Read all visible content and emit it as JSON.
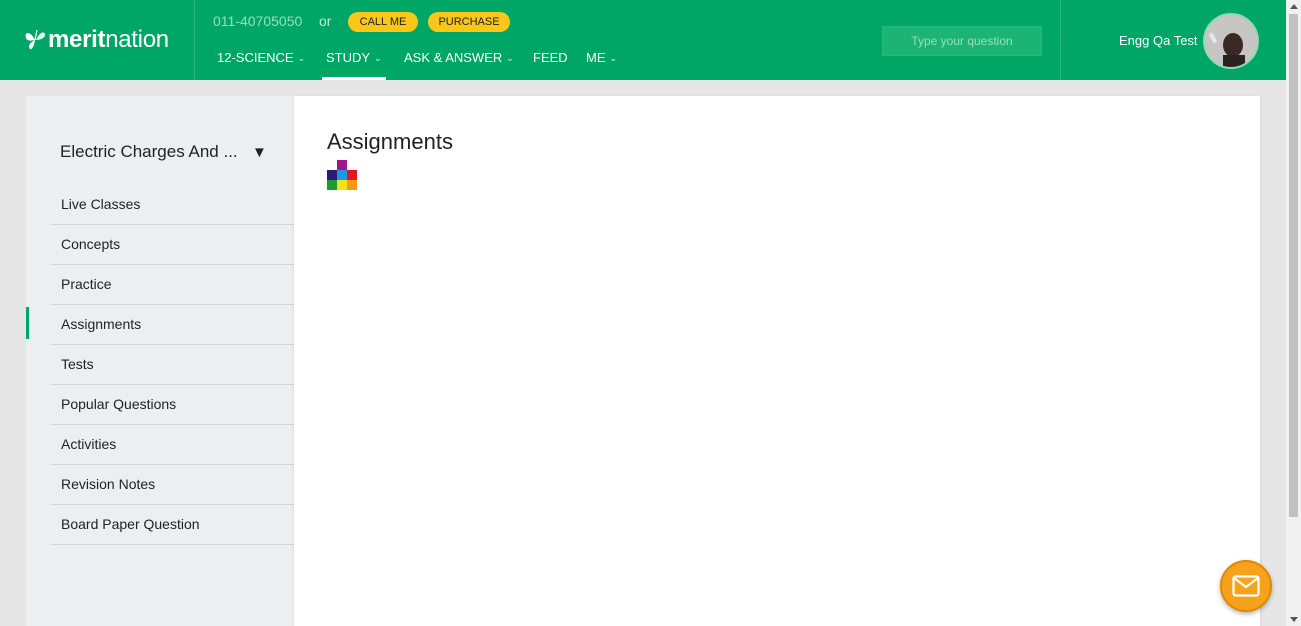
{
  "header": {
    "logo_text_bold": "merit",
    "logo_text_light": "nation",
    "phone": "011-40705050",
    "or_text": "or",
    "call_button": "CALL ME",
    "purchase_button": "PURCHASE",
    "nav": [
      {
        "label": "12-SCIENCE",
        "has_dropdown": true
      },
      {
        "label": "STUDY",
        "has_dropdown": true,
        "active": true
      },
      {
        "label": "ASK & ANSWER",
        "has_dropdown": true
      },
      {
        "label": "FEED",
        "has_dropdown": false
      },
      {
        "label": "ME",
        "has_dropdown": true
      }
    ],
    "search_placeholder": "Type your question",
    "username": "Engg Qa Test"
  },
  "sidebar": {
    "chapter": "Electric Charges And ...",
    "caret_icon": "triangle-down-icon",
    "items": [
      {
        "label": "Live Classes"
      },
      {
        "label": "Concepts"
      },
      {
        "label": "Practice"
      },
      {
        "label": "Assignments",
        "active": true
      },
      {
        "label": "Tests"
      },
      {
        "label": "Popular Questions"
      },
      {
        "label": "Activities"
      },
      {
        "label": "Revision Notes"
      },
      {
        "label": "Board Paper Question"
      }
    ]
  },
  "main": {
    "title": "Assignments",
    "loader_icon": "loading-blocks-icon"
  },
  "chat": {
    "icon": "envelope-icon"
  },
  "colors": {
    "brand_green": "#00a665",
    "pill_yellow": "#f9c718",
    "chat_orange": "#f7a21b"
  }
}
